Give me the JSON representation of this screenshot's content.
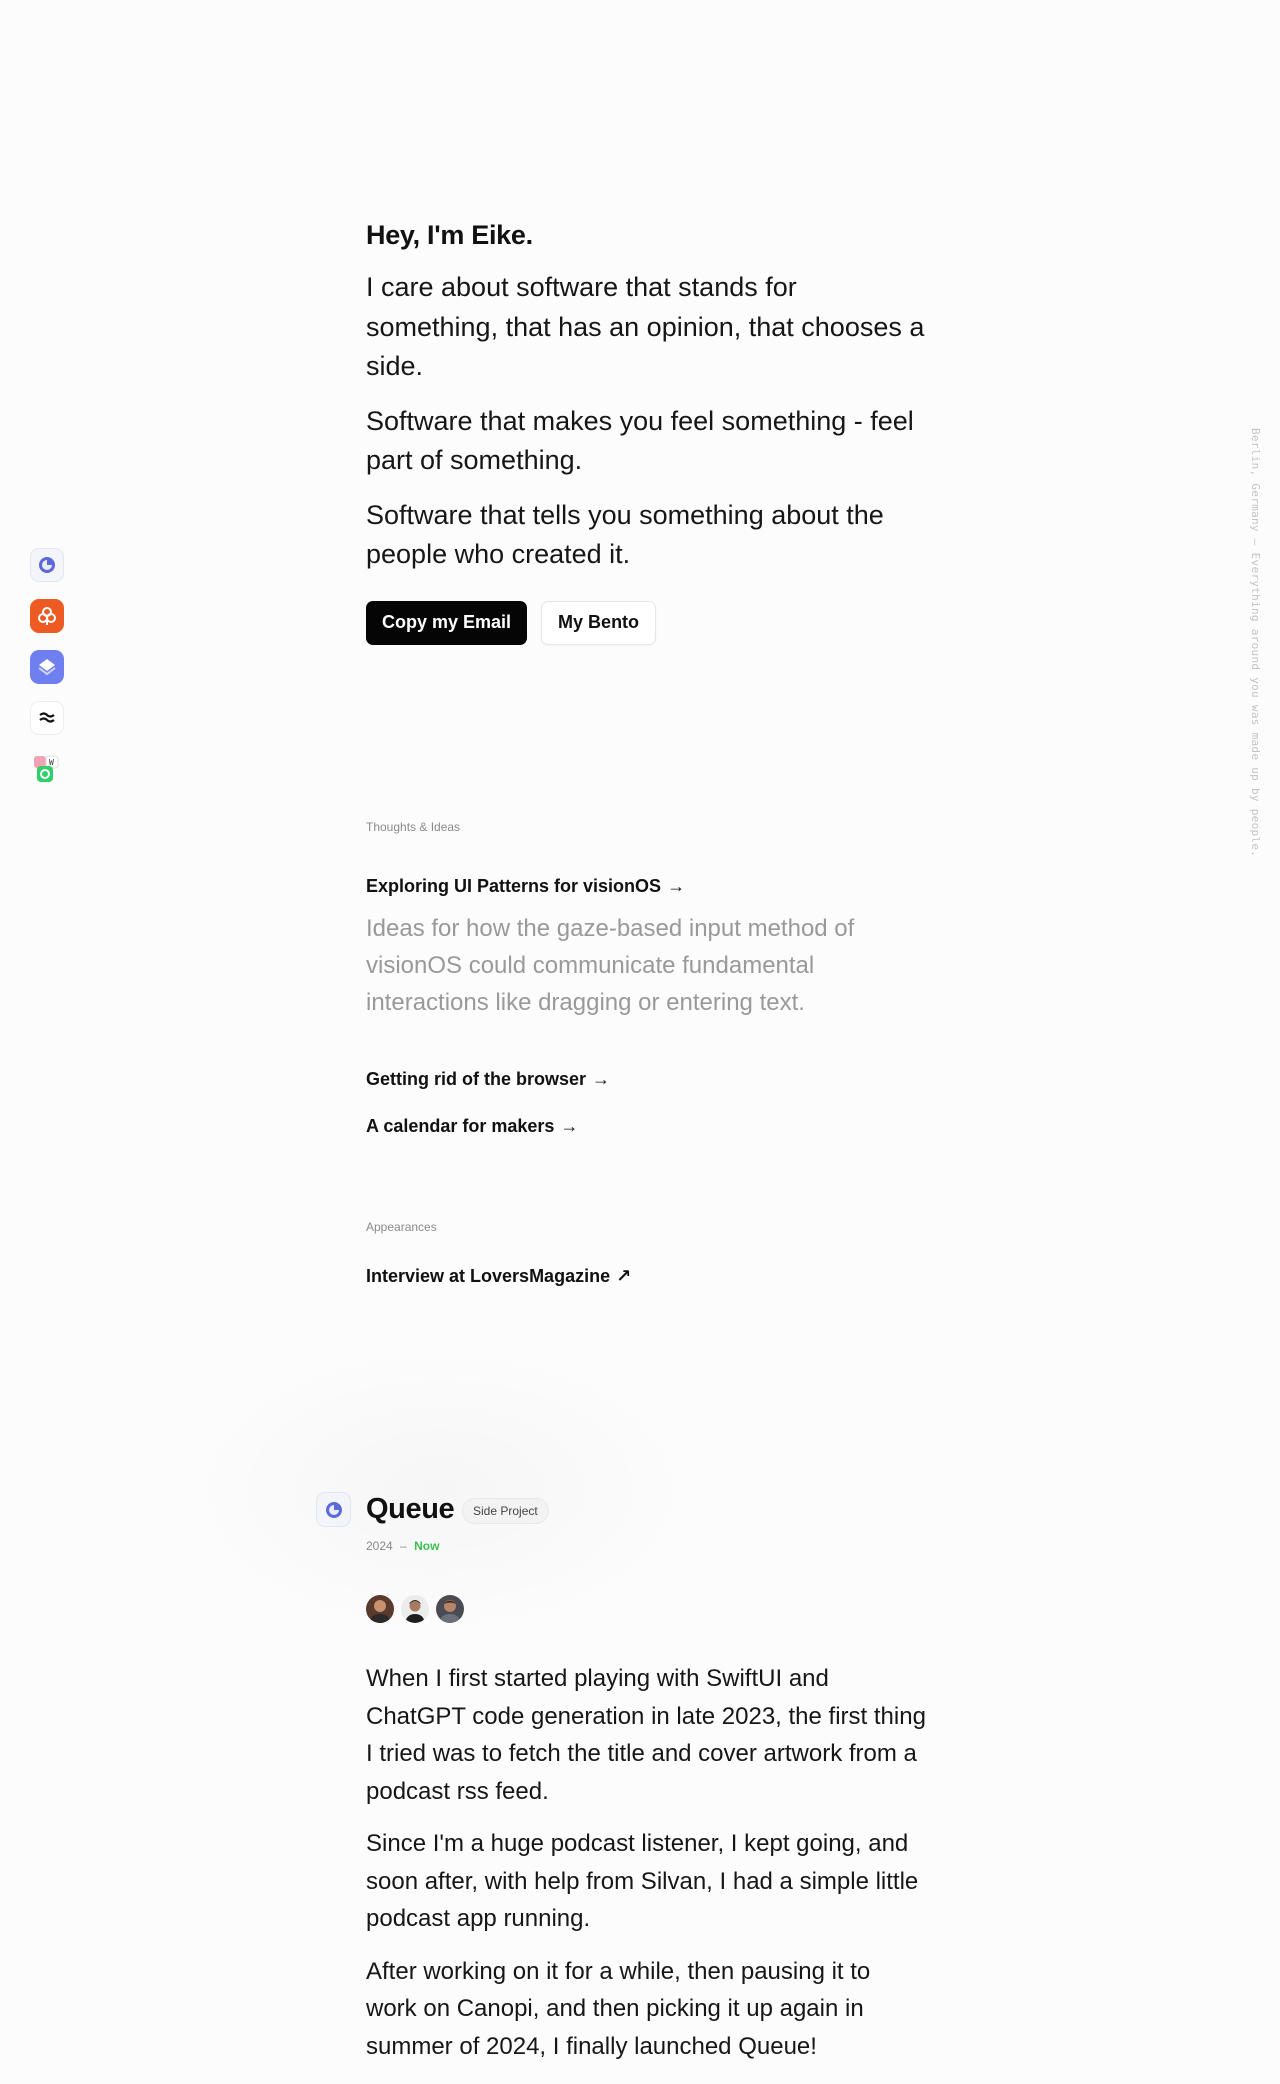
{
  "rail": {
    "items": [
      {
        "name": "Queue",
        "icon": "queue-icon"
      },
      {
        "name": "Canopi",
        "icon": "canopi-icon"
      },
      {
        "name": "Layers",
        "icon": "layers-icon"
      },
      {
        "name": "Flow",
        "icon": "flow-icon"
      },
      {
        "name": "Multi app",
        "icon": "multi-app-icon"
      }
    ]
  },
  "side_text": "Berlin, Germany — Everything around you was made up by people.",
  "hero": {
    "greeting": "Hey, I'm Eike.",
    "paragraphs": [
      "I care about software that stands for something, that has an opinion, that chooses a side.",
      "Software that makes you feel something - feel part of something.",
      "Software that tells you something about the people who created it."
    ],
    "primary_button": "Copy my Email",
    "secondary_button": "My Bento"
  },
  "thoughts": {
    "label": "Thoughts & Ideas",
    "posts": [
      {
        "title": "Exploring UI Patterns for visionOS",
        "arrow": "→",
        "description": "Ideas for how the gaze-based input method of visionOS could communicate fundamental interactions like dragging or entering text."
      },
      {
        "title": "Getting rid of the browser",
        "arrow": "→"
      },
      {
        "title": "A calendar for makers",
        "arrow": "→"
      }
    ]
  },
  "appearances": {
    "label": "Appearances",
    "items": [
      {
        "title": "Interview at LoversMagazine",
        "arrow": "↗"
      }
    ]
  },
  "project": {
    "title": "Queue",
    "badge": "Side Project",
    "year_start": "2024",
    "separator": "–",
    "year_end": "Now",
    "paragraphs": [
      "When I first started playing with SwiftUI and ChatGPT code generation in late 2023, the first thing I tried was to fetch the title and cover artwork from a podcast rss feed.",
      "Since I'm a huge podcast listener, I kept going, and soon after, with help from Silvan, I had a simple little podcast app running.",
      "After working on it for a while, then pausing it to work on Canopi, and then picking it up again in summer of 2024, I finally launched Queue!"
    ]
  },
  "colors": {
    "background": "#fcfcfc",
    "accent_now": "#3cbf4e",
    "primary_button": "#050505"
  }
}
